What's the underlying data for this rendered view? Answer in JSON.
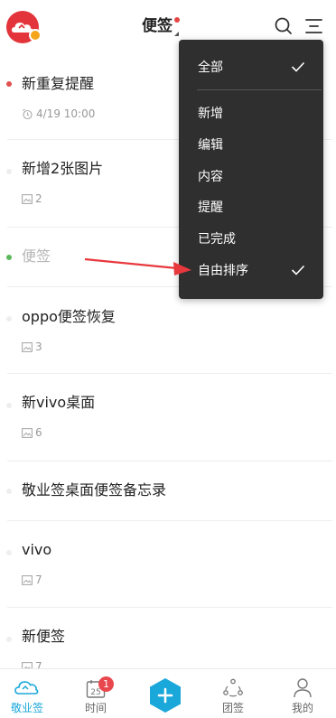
{
  "header": {
    "title": "便签"
  },
  "notes": [
    {
      "title": "新重复提醒",
      "meta": "4/19 10:00",
      "meta_icon": "alarm-repeat-icon",
      "dot_color": "#e05050"
    },
    {
      "title": "新增2张图片",
      "meta": "2",
      "meta_icon": "image-icon",
      "dot_color": "#eeeeee"
    },
    {
      "title": "便签",
      "meta": "",
      "meta_icon": "",
      "dot_color": "#5cb85c"
    },
    {
      "title": "oppo便签恢复",
      "meta": "3",
      "meta_icon": "image-icon",
      "dot_color": "#eeeeee"
    },
    {
      "title": "新vivo桌面",
      "meta": "6",
      "meta_icon": "image-icon",
      "dot_color": "#eeeeee"
    },
    {
      "title": "敬业签桌面便签备忘录",
      "meta": "",
      "meta_icon": "",
      "dot_color": "#eeeeee"
    },
    {
      "title": "vivo",
      "meta": "7",
      "meta_icon": "image-icon",
      "dot_color": "#eeeeee"
    },
    {
      "title": "新便签",
      "meta": "7",
      "meta_icon": "image-icon",
      "dot_color": "#eeeeee"
    }
  ],
  "menu": {
    "items": [
      {
        "label": "全部",
        "checked": true
      },
      {
        "label": "新增",
        "checked": false
      },
      {
        "label": "编辑",
        "checked": false
      },
      {
        "label": "内容",
        "checked": false
      },
      {
        "label": "提醒",
        "checked": false
      },
      {
        "label": "已完成",
        "checked": false
      },
      {
        "label": "自由排序",
        "checked": true
      }
    ]
  },
  "tabbar": {
    "tabs": [
      {
        "label": "敬业签",
        "icon": "cloud-icon",
        "active": true
      },
      {
        "label": "时间",
        "icon": "calendar-icon",
        "active": false,
        "badge": "1",
        "calendar_day": "25"
      },
      {
        "label": "",
        "icon": "plus-icon",
        "active": false
      },
      {
        "label": "团签",
        "icon": "team-icon",
        "active": false
      },
      {
        "label": "我的",
        "icon": "user-icon",
        "active": false
      }
    ]
  },
  "colors": {
    "accent": "#1aa7d9",
    "brand_red": "#e2343a",
    "menu_bg": "#2f2f2f",
    "annotation_arrow": "#e8383d"
  }
}
